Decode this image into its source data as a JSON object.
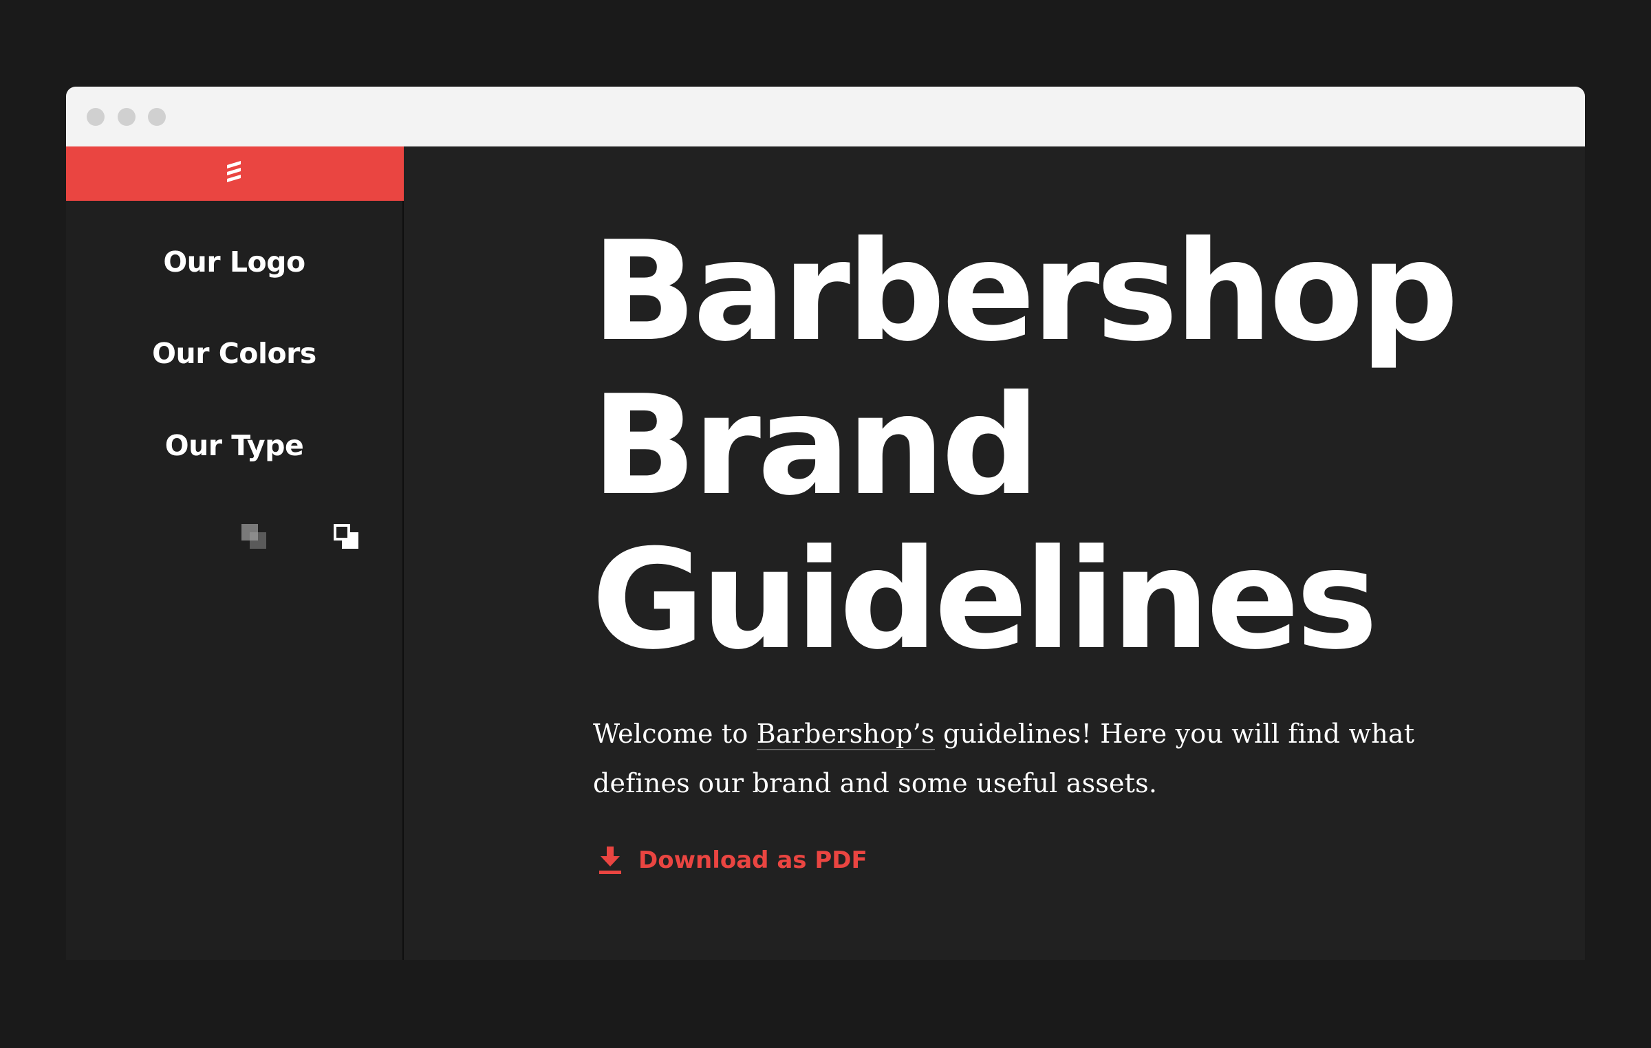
{
  "sidebar": {
    "brand_icon": "barbershop-stripes-icon",
    "items": [
      {
        "label": "Our Logo"
      },
      {
        "label": "Our Colors"
      },
      {
        "label": "Our Type"
      }
    ],
    "theme_toggles": [
      "dark-theme-icon",
      "light-theme-icon"
    ]
  },
  "main": {
    "title_lines": [
      "Barbershop",
      "Brand",
      "Guidelines"
    ],
    "intro": {
      "before_link": "Welcome to ",
      "link": "Barbershop’s",
      "after_link": " guidelines! Here you will find what defines our brand and some useful assets."
    },
    "download": {
      "icon": "download-icon",
      "label": "Download as PDF"
    }
  },
  "colors": {
    "accent": "#ea4541",
    "background": "#212121",
    "sidebar": "#1f1f1f",
    "text": "#ffffff",
    "titlebar": "#f3f3f3"
  }
}
